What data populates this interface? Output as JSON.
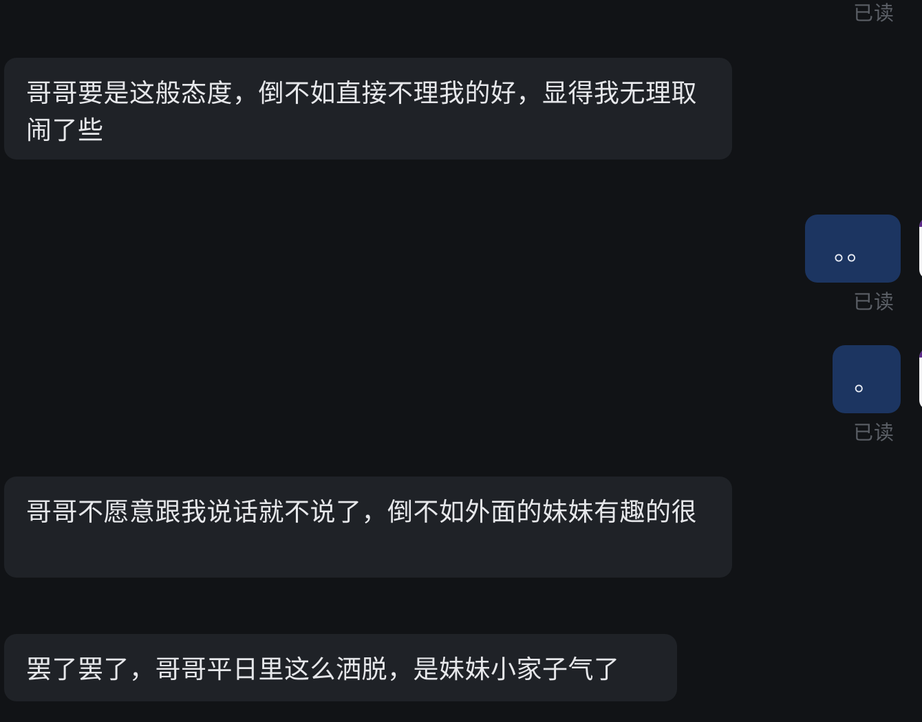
{
  "status": {
    "read_label": "已读"
  },
  "messages": [
    {
      "direction": "incoming",
      "text": "哥哥要是这般态度，倒不如直接不理我的好，显得我无理取闹了些"
    },
    {
      "direction": "outgoing",
      "text": "。。",
      "read": "已读"
    },
    {
      "direction": "outgoing",
      "text": "。",
      "read": "已读"
    },
    {
      "direction": "incoming",
      "text": "哥哥不愿意跟我说话就不说了，倒不如外面的妹妹有趣的很"
    },
    {
      "direction": "incoming",
      "text": "罢了罢了，哥哥平日里这么洒脱，是妹妹小家子气了"
    }
  ]
}
